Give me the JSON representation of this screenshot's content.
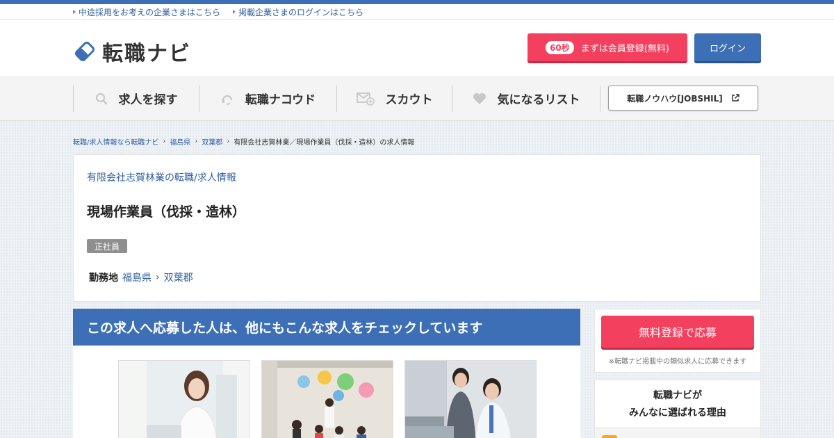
{
  "utility": {
    "link1": "中途採用をお考えの企業さまはこちら",
    "link2": "掲載企業さまのログインはこちら"
  },
  "header": {
    "logo_text": "転職ナビ",
    "register_badge": "60秒",
    "register_label": "まずは会員登録(無料)",
    "login_label": "ログイン"
  },
  "nav": {
    "items": [
      {
        "label": "求人を探す",
        "icon": "search-icon"
      },
      {
        "label": "転職ナコウド",
        "icon": "headset-icon"
      },
      {
        "label": "スカウト",
        "icon": "mail-plus-icon"
      },
      {
        "label": "気になるリスト",
        "icon": "heart-icon"
      }
    ],
    "external_label": "転職ノウハウ[JOBSHIL]"
  },
  "breadcrumb": {
    "items": [
      "転職/求人情報なら転職ナビ",
      "福島県",
      "双葉郡"
    ],
    "current": "有限会社志賀林業／現場作業員（伐採・造林）の求人情報"
  },
  "job": {
    "company_link": "有限会社志賀林業の転職/求人情報",
    "title": "現場作業員（伐採・造林）",
    "employment_type": "正社員",
    "location_label": "勤務地",
    "prefecture": "福島県",
    "district": "双葉郡"
  },
  "recommend": {
    "heading": "この求人へ応募した人は、他にもこんな求人をチェックしています"
  },
  "sidebar": {
    "apply_label": "無料登録で応募",
    "apply_note": "※転職ナビ掲載中の類似求人に応募できます",
    "why_line1": "転職ナビが",
    "why_line2": "みんなに選ばれる理由"
  },
  "colors": {
    "brand_blue": "#3d6fb6",
    "accent_red": "#f4405f",
    "link_blue": "#2f5f9e"
  }
}
